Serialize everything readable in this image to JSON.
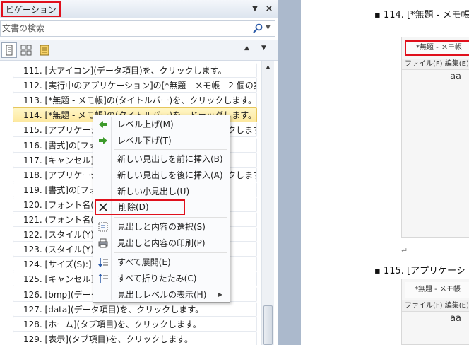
{
  "nav_pane": {
    "title": "ビゲーション",
    "menu_arrow": "▼",
    "close_symbol": "×",
    "search_placeholder": "文書の検索",
    "search_dropdown": "▼",
    "prev_arrow": "▲",
    "next_arrow": "▼"
  },
  "headings": [
    "111. [大アイコン](データ項目)を、クリックします。",
    "112. [実行中のアプリケーション]の[*無題 - メモ帳 - 2 個の実…",
    "113. [*無題 - メモ帳]の(タイトルバー)を、クリックします。",
    "114. [*無題 - メモ帳]の(タイトルバー)を、ドラッグします。",
    "115. [アプリケーションの切り替え]の(…)を、クリックします。",
    "116. [書式]の[フォント]",
    "117. [キャンセル](ボタン)",
    "118. [アプリケーションの切り替え]の(…)を、クリックします。",
    "119. [書式]の[フォント]",
    "120. [フォント名(F)]",
    "121. (フォント名(F))",
    "122. [スタイル(Y)]",
    "123. (スタイル(Y))",
    "124. [サイズ(S):]",
    "125. [キャンセル](ボタン)",
    "126. [bmp](データ項目)",
    "127. [data](データ項目)を、クリックします。",
    "128. [ホーム](タブ項目)を、クリックします。",
    "129. [表示](タブ項目)を、クリックします。"
  ],
  "context_menu": {
    "items": [
      {
        "label": "レベル上げ(M)"
      },
      {
        "label": "レベル下げ(T)"
      },
      {
        "label": "新しい見出しを前に挿入(B)"
      },
      {
        "label": "新しい見出しを後に挿入(A)"
      },
      {
        "label": "新しい小見出し(U)"
      },
      {
        "label": "削除(D)"
      },
      {
        "label": "見出しと内容の選択(S)"
      },
      {
        "label": "見出しと内容の印刷(P)"
      },
      {
        "label": "すべて展開(E)"
      },
      {
        "label": "すべて折りたたみ(C)"
      },
      {
        "label": "見出しレベルの表示(H)"
      }
    ],
    "submenu_arrow": "▶"
  },
  "document": {
    "heading_114": "114. [*無題 - メモ帳]",
    "heading_115": "115. [アプリケーシ",
    "shot1_title": "*無題 - メモ帳",
    "shot1_menu": "ファイル(F)  編集(E)",
    "shot1_body": "aa",
    "shot2_title": "*無題 - メモ帳",
    "shot2_menu": "ファイル(F)  編集(E)",
    "shot2_body": "aa",
    "return_mark": "↵"
  },
  "colors": {
    "highlight_border": "#e0101c",
    "selected_bg": "#fde9a0",
    "app_bg": "#abb9cc"
  }
}
